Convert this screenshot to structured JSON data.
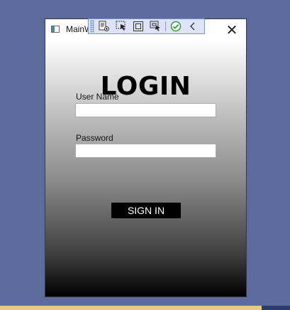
{
  "window": {
    "title": "MainW",
    "close_glyph": "✕"
  },
  "debug_toolbar": {
    "tools": [
      {
        "icon": "live-visual-tree-icon"
      },
      {
        "icon": "select-element-icon"
      },
      {
        "icon": "display-layout-adorners-icon"
      },
      {
        "icon": "track-focused-element-icon"
      },
      {
        "icon": "binding-check-icon",
        "color": "#2e9b3c"
      },
      {
        "icon": "collapse-chevron-icon"
      }
    ]
  },
  "login": {
    "heading": "LOGIN",
    "username_label": "User Name",
    "username_value": "",
    "password_label": "Password",
    "password_value": "",
    "sign_in_label": "SIGN IN"
  },
  "colors": {
    "desktop": "#5d6a9c",
    "button_bg": "#000000",
    "button_text": "#ffffff"
  }
}
